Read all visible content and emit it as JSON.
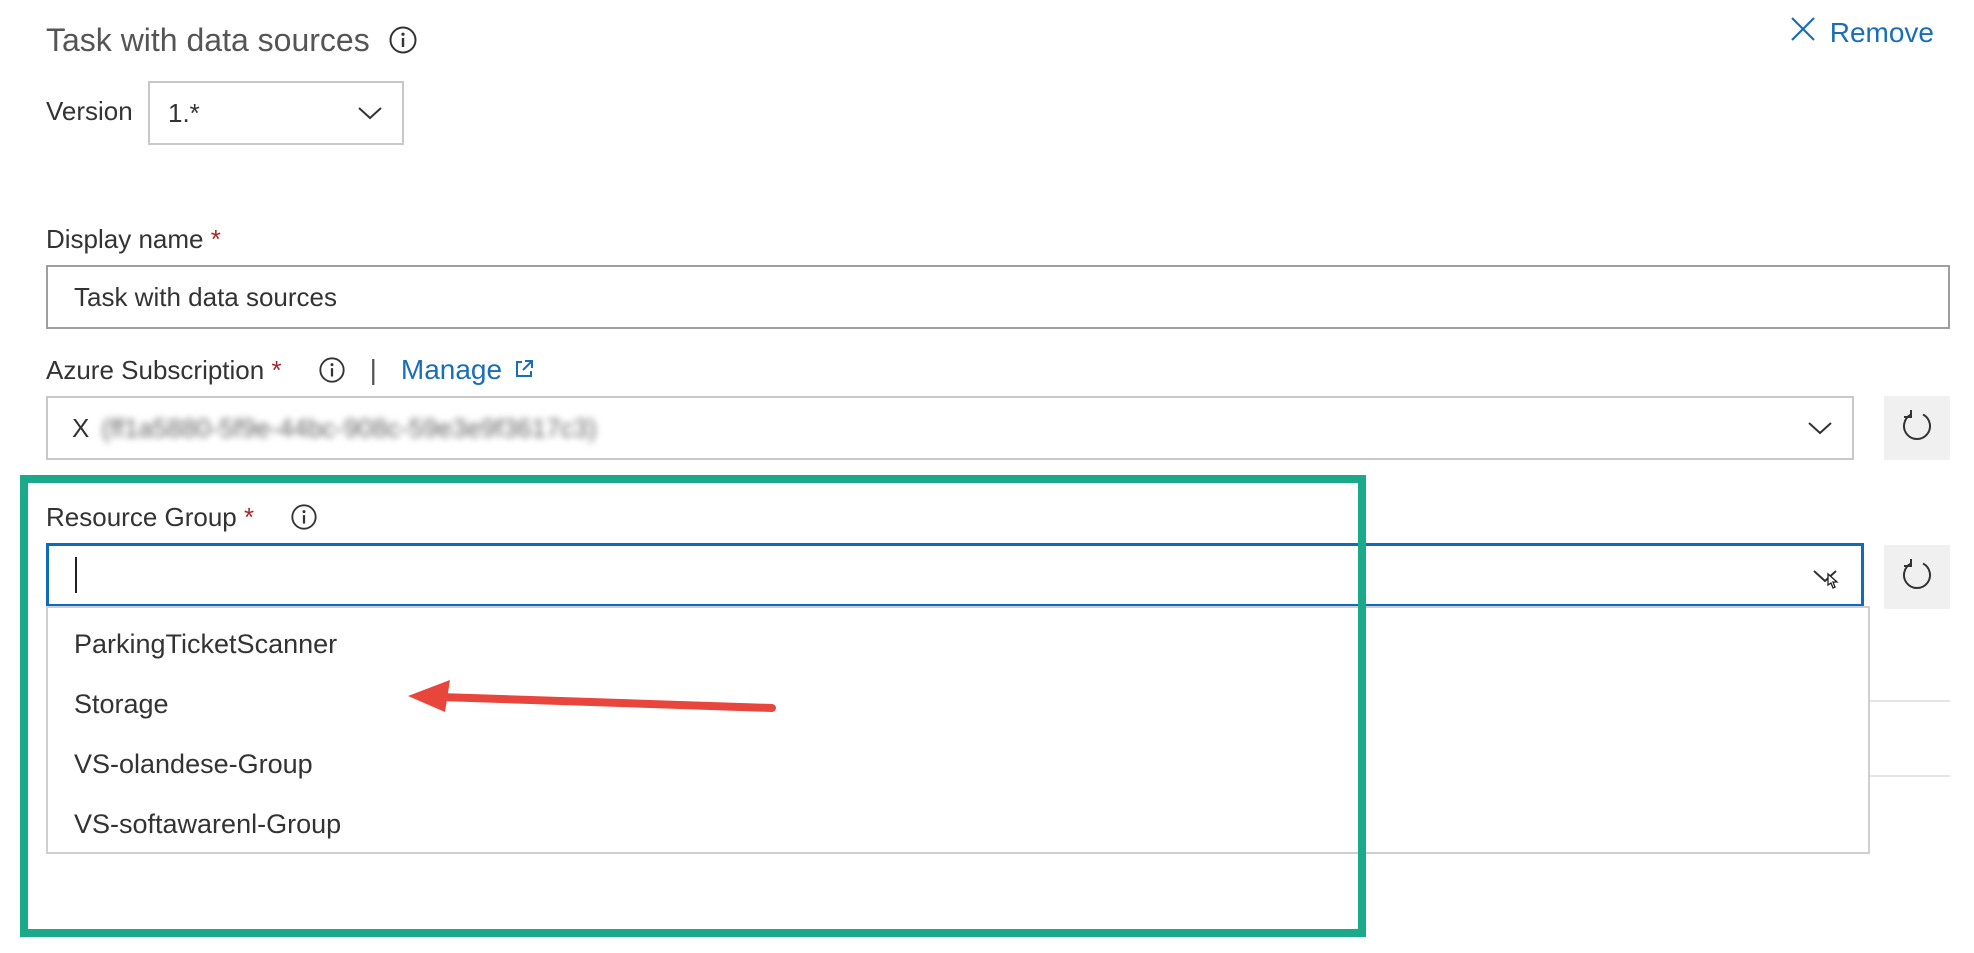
{
  "header": {
    "title": "Task with data sources",
    "remove_label": "Remove"
  },
  "version": {
    "label": "Version",
    "value": "1.*"
  },
  "display_name": {
    "label": "Display name",
    "required_mark": "*",
    "value": "Task with data sources"
  },
  "azure_subscription": {
    "label": "Azure Subscription",
    "required_mark": "*",
    "separator": "|",
    "manage_label": "Manage",
    "value_prefix": "X",
    "value_redacted": "(ff1a5880-5f9e-44bc-908c-59e3e9f3617c3)"
  },
  "resource_group": {
    "label": "Resource Group",
    "required_mark": "*",
    "input_value": "",
    "options": [
      "ParkingTicketScanner",
      "Storage",
      "VS-olandese-Group",
      "VS-softawarenl-Group"
    ]
  },
  "colors": {
    "accent_link": "#1a6eb8",
    "focus_border": "#0f6cbd",
    "highlight_box": "#1aaa8a",
    "arrow": "#e8453c",
    "required": "#a4262c"
  }
}
